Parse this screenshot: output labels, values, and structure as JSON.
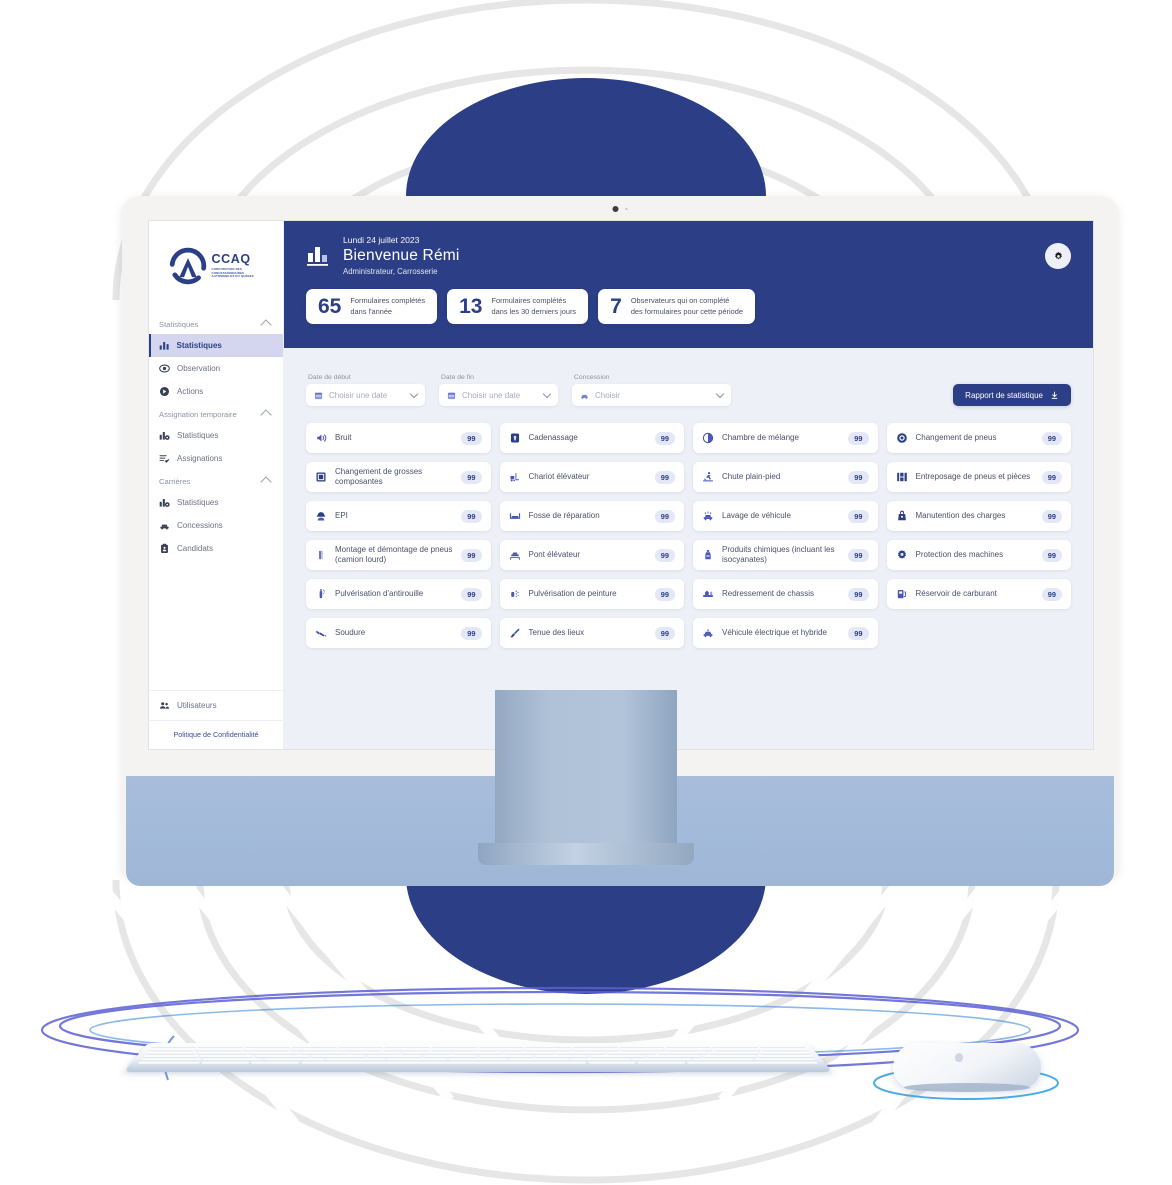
{
  "brand": {
    "logo_name": "CCAQ",
    "logo_subtitle": "CORPORATION DES CONCESSIONNAIRES AUTOMOBILES DU QUÉBEC",
    "accent": "#2c3f86",
    "surface": "#eef0f7",
    "badge_bg": "#e4e7f6"
  },
  "sidebar": {
    "groups": [
      {
        "title": "Statistiques",
        "items": [
          {
            "label": "Statistiques",
            "icon": "bar-chart-icon",
            "active": true
          },
          {
            "label": "Observation",
            "icon": "eye-icon",
            "active": false
          },
          {
            "label": "Actions",
            "icon": "action-circle-icon",
            "active": false
          }
        ]
      },
      {
        "title": "Assignation temporaire",
        "items": [
          {
            "label": "Statistiques",
            "icon": "bar-chart-gear-icon",
            "active": false
          },
          {
            "label": "Assignations",
            "icon": "list-check-icon",
            "active": false
          }
        ]
      },
      {
        "title": "Carrières",
        "items": [
          {
            "label": "Statistiques",
            "icon": "bar-chart-gear-icon",
            "active": false
          },
          {
            "label": "Concessions",
            "icon": "car-icon",
            "active": false
          },
          {
            "label": "Candidats",
            "icon": "clipboard-user-icon",
            "active": false
          }
        ]
      }
    ],
    "bottom_item": {
      "label": "Utilisateurs",
      "icon": "users-icon"
    },
    "privacy_link": "Politique de Confidentialité"
  },
  "header": {
    "date": "Lundi 24 juillet 2023",
    "greeting": "Bienvenue Rémi",
    "role": "Administrateur, Carrosserie",
    "settings_icon": "gear-icon",
    "stats": [
      {
        "value": "65",
        "label_line1": "Formulaires complétés",
        "label_line2": "dans l'année"
      },
      {
        "value": "13",
        "label_line1": "Formulaires complétés",
        "label_line2": "dans les 30 derniers jours"
      },
      {
        "value": "7",
        "label_line1": "Observateurs qui on complété",
        "label_line2": "des formulaires pour cette période"
      }
    ]
  },
  "filters": {
    "start_date": {
      "label": "Date de début",
      "placeholder": "Choisir une date",
      "icon": "calendar-icon"
    },
    "end_date": {
      "label": "Date de fin",
      "placeholder": "Choisir une date",
      "icon": "calendar-icon"
    },
    "concession": {
      "label": "Concession",
      "placeholder": "Choisir",
      "icon": "car-icon"
    },
    "report_button": {
      "label": "Rapport de statistique",
      "icon": "download-icon"
    }
  },
  "tiles": [
    {
      "label": "Bruit",
      "count": "99",
      "icon": "noise-icon"
    },
    {
      "label": "Cadenassage",
      "count": "99",
      "icon": "padlock-icon"
    },
    {
      "label": "Chambre de mélange",
      "count": "99",
      "icon": "half-circle-icon"
    },
    {
      "label": "Changement de pneus",
      "count": "99",
      "icon": "tire-icon"
    },
    {
      "label": "Changement de grosses composantes",
      "count": "99",
      "icon": "component-square-icon"
    },
    {
      "label": "Chariot élévateur",
      "count": "99",
      "icon": "forklift-icon"
    },
    {
      "label": "Chute plain-pied",
      "count": "99",
      "icon": "slip-fall-icon"
    },
    {
      "label": "Entreposage de pneus et pièces",
      "count": "99",
      "icon": "storage-shelf-icon"
    },
    {
      "label": "EPI",
      "count": "99",
      "icon": "ppe-worker-icon"
    },
    {
      "label": "Fosse de réparation",
      "count": "99",
      "icon": "repair-pit-icon"
    },
    {
      "label": "Lavage de véhicule",
      "count": "99",
      "icon": "car-wash-icon"
    },
    {
      "label": "Manutention des charges",
      "count": "99",
      "icon": "lifting-bag-icon"
    },
    {
      "label": "Montage et démontage de pneus (camion lourd)",
      "count": "99",
      "icon": "tire-mount-icon"
    },
    {
      "label": "Pont élévateur",
      "count": "99",
      "icon": "car-lift-icon"
    },
    {
      "label": "Produits chimiques (incluant les isocyanates)",
      "count": "99",
      "icon": "chemical-bottle-icon"
    },
    {
      "label": "Protection des machines",
      "count": "99",
      "icon": "machine-guard-icon"
    },
    {
      "label": "Pulvérisation d'antirouille",
      "count": "99",
      "icon": "spray-rustproof-icon"
    },
    {
      "label": "Pulvérisation de peinture",
      "count": "99",
      "icon": "spray-paint-icon"
    },
    {
      "label": "Redressement de chassis",
      "count": "99",
      "icon": "chassis-straighten-icon"
    },
    {
      "label": "Réservoir de carburant",
      "count": "99",
      "icon": "fuel-tank-icon"
    },
    {
      "label": "Soudure",
      "count": "99",
      "icon": "welding-icon"
    },
    {
      "label": "Tenue des lieux",
      "count": "99",
      "icon": "housekeeping-icon"
    },
    {
      "label": "Véhicule électrique et hybride",
      "count": "99",
      "icon": "ev-car-icon"
    }
  ]
}
